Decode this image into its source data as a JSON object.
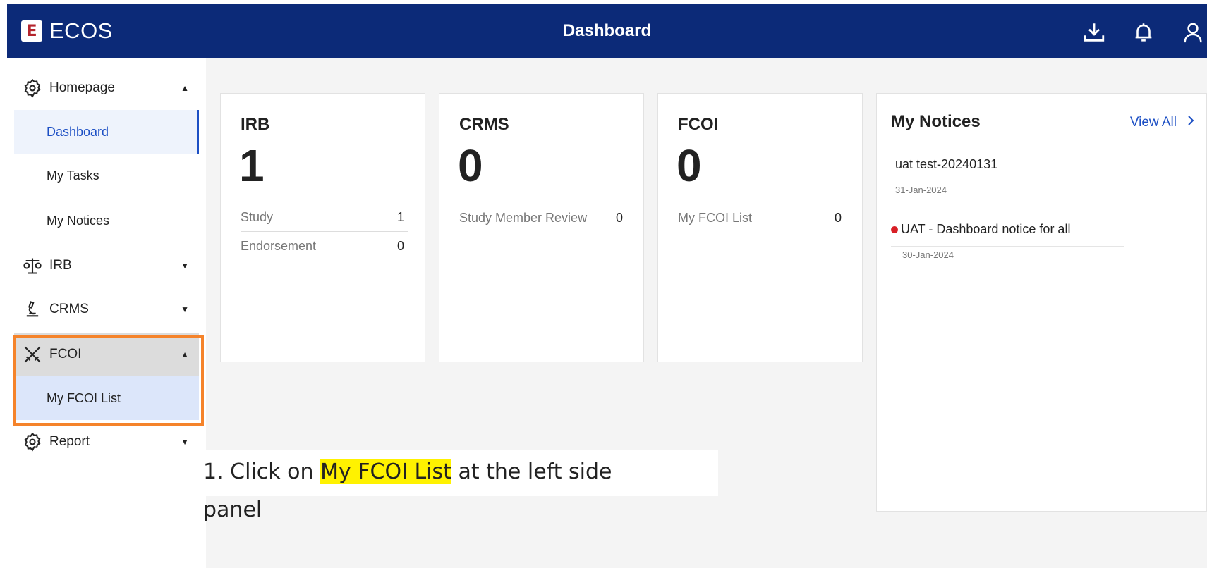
{
  "header": {
    "app_name": "ECOS",
    "logo_letter": "E",
    "title": "Dashboard",
    "icons": [
      "download-icon",
      "bell-icon",
      "user-icon"
    ]
  },
  "sidebar": {
    "homepage": {
      "label": "Homepage",
      "icon": "gear-icon"
    },
    "dashboard": "Dashboard",
    "my_tasks": "My Tasks",
    "my_notices": "My Notices",
    "irb": {
      "label": "IRB",
      "icon": "scale-icon"
    },
    "crms": {
      "label": "CRMS",
      "icon": "microscope-icon"
    },
    "fcoi": {
      "label": "FCOI",
      "icon": "crossed-swords-icon"
    },
    "my_fcoi_list": "My FCOI List",
    "report": {
      "label": "Report",
      "icon": "gear-icon"
    }
  },
  "cards": {
    "irb": {
      "title": "IRB",
      "count": "1",
      "rows": [
        {
          "label": "Study",
          "value": "1"
        },
        {
          "label": "Endorsement",
          "value": "0"
        }
      ]
    },
    "crms": {
      "title": "CRMS",
      "count": "0",
      "rows": [
        {
          "label": "Study Member Review",
          "value": "0"
        }
      ]
    },
    "fcoi": {
      "title": "FCOI",
      "count": "0",
      "rows": [
        {
          "label": "My FCOI List",
          "value": "0"
        }
      ]
    }
  },
  "notices": {
    "title": "My Notices",
    "view_all": "View All",
    "items": [
      {
        "title": "uat test-20240131",
        "date": "31-Jan-2024",
        "unread": false
      },
      {
        "title": "UAT - Dashboard notice for all",
        "date": "30-Jan-2024",
        "unread": true
      }
    ]
  },
  "instruction": {
    "prefix": "1. Click on ",
    "highlight": "My FCOI List",
    "suffix": " at the left side",
    "line2": "panel"
  },
  "colors": {
    "header_bg": "#0c2a78",
    "accent_blue": "#1c4fc4",
    "highlight_orange": "#f5832a",
    "highlight_yellow": "#fff200",
    "unread_red": "#d81f26"
  }
}
